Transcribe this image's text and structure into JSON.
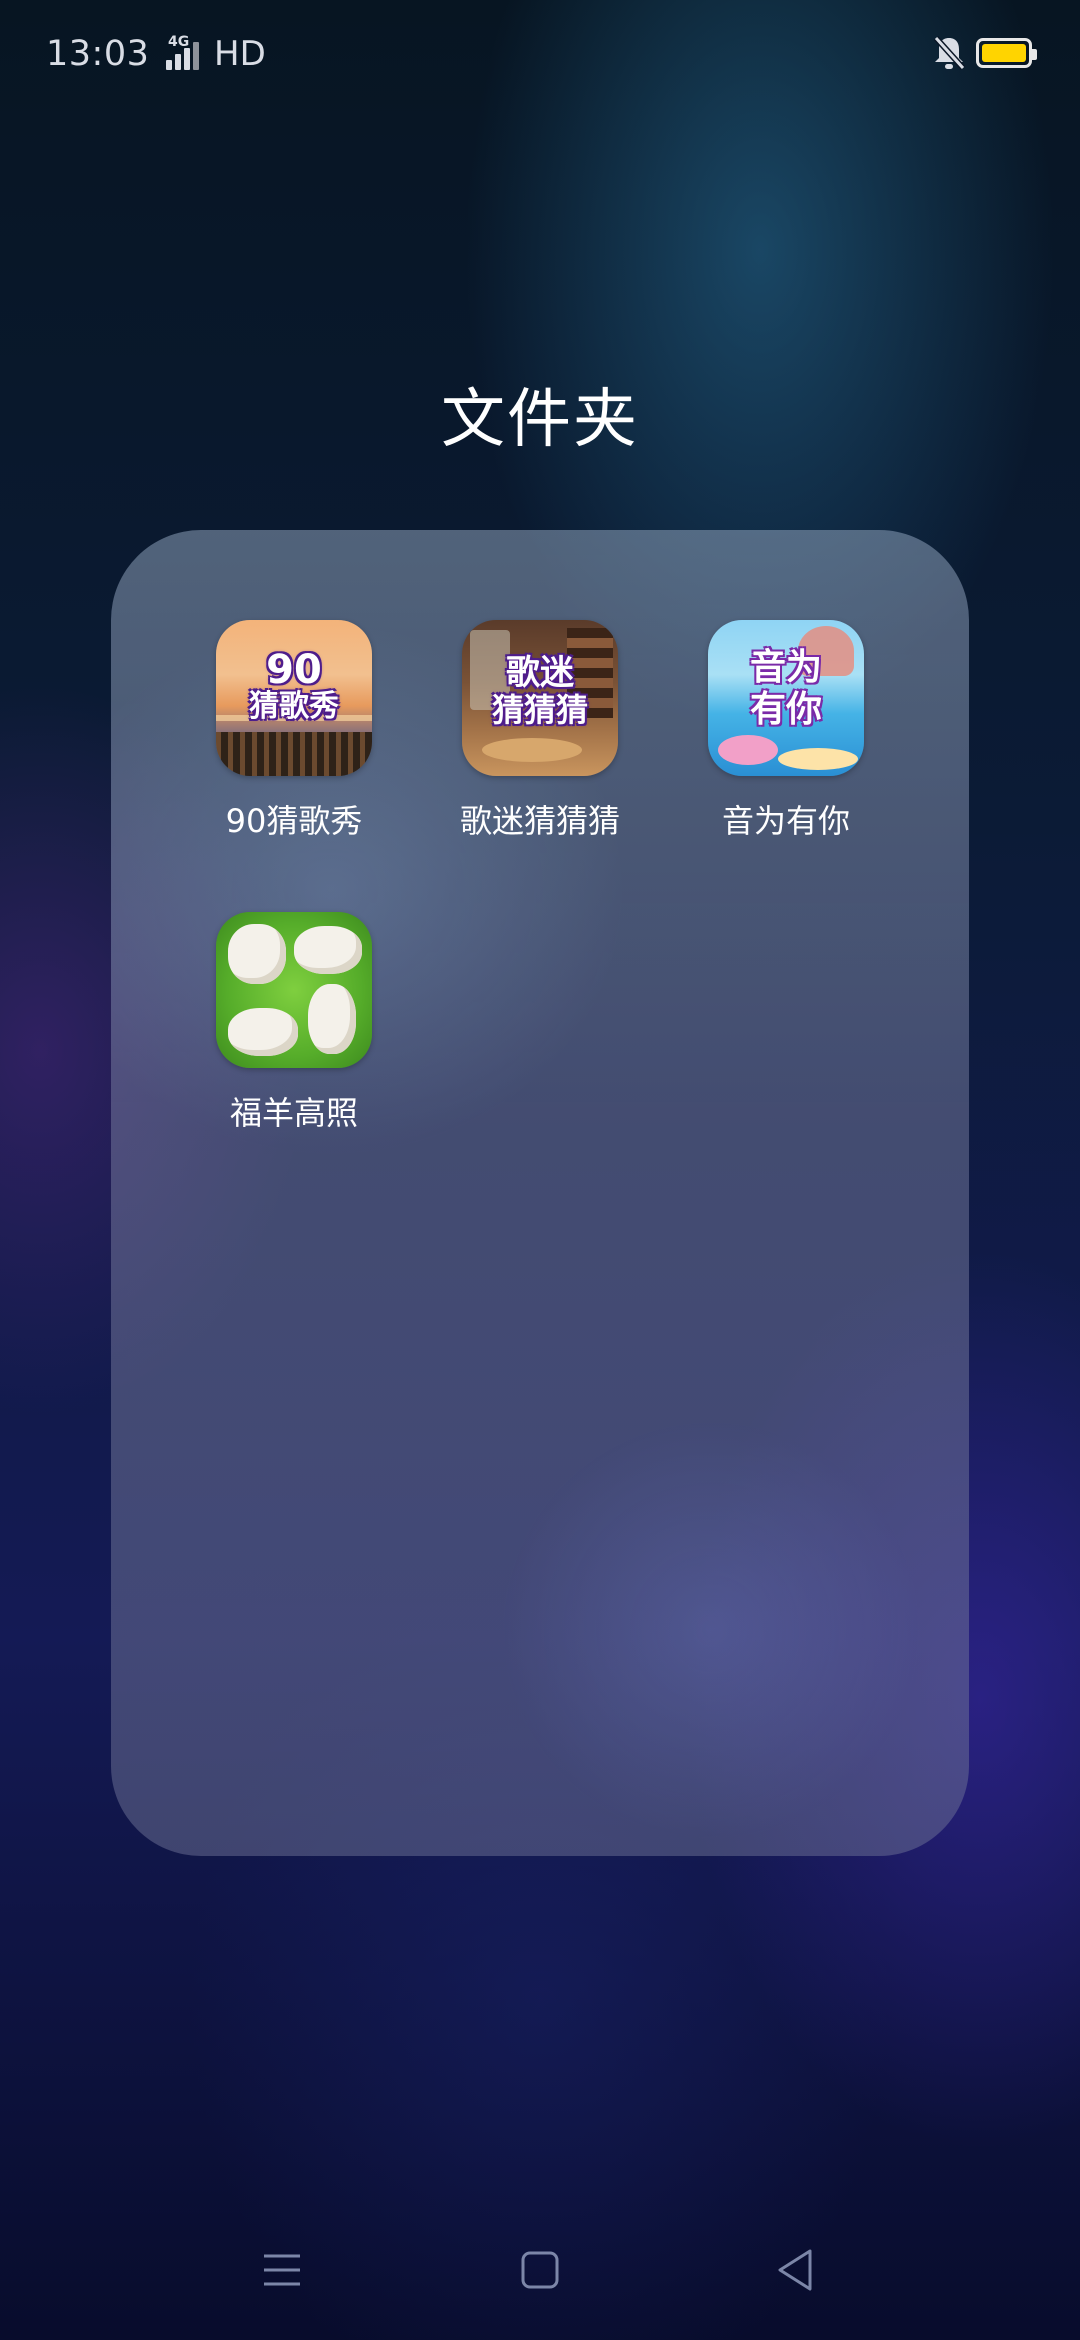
{
  "status_bar": {
    "time": "13:03",
    "network": "4G",
    "hd_label": "HD",
    "icons": [
      "signal-icon",
      "mute-bell-icon",
      "battery-icon"
    ],
    "battery_color": "#ffd400"
  },
  "folder": {
    "title": "文件夹",
    "apps": [
      {
        "label": "90猜歌秀",
        "icon": "app-icon-90-guess-song",
        "icon_text_top": "90",
        "icon_text_bottom": "猜歌秀"
      },
      {
        "label": "歌迷猜猜猜",
        "icon": "app-icon-fan-guess",
        "icon_text_top": "歌迷",
        "icon_text_bottom": "猜猜猜"
      },
      {
        "label": "音为有你",
        "icon": "app-icon-music-with-you",
        "icon_text_top": "音为",
        "icon_text_bottom": "有你"
      },
      {
        "label": "福羊高照",
        "icon": "app-icon-lucky-sheep"
      }
    ]
  },
  "nav_bar": {
    "icons": [
      "menu-icon",
      "home-icon",
      "back-icon"
    ]
  }
}
